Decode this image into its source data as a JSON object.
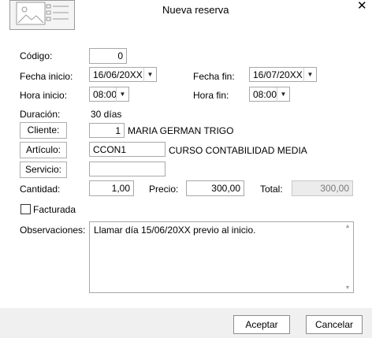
{
  "title": "Nueva reserva",
  "close_glyph": "✕",
  "icons": {
    "header": "image-list-icon",
    "close": "close-icon",
    "dropdown": "chevron-down-icon"
  },
  "labels": {
    "codigo": "Código:",
    "fecha_inicio": "Fecha inicio:",
    "fecha_fin": "Fecha fin:",
    "hora_inicio": "Hora inicio:",
    "hora_fin": "Hora fin:",
    "duracion": "Duración:",
    "cantidad": "Cantidad:",
    "precio": "Precio:",
    "total": "Total:",
    "observaciones": "Observaciones:",
    "facturada": "Facturada"
  },
  "values": {
    "codigo": "0",
    "fecha_inicio": "16/06/20XX",
    "fecha_fin": "16/07/20XX",
    "hora_inicio": "08:00",
    "hora_fin": "08:00",
    "duracion": "30 días",
    "cliente_id": "1",
    "cliente_name": "MARIA GERMAN TRIGO",
    "articulo_code": "CCON1",
    "articulo_name": "CURSO CONTABILIDAD MEDIA",
    "servicio": "",
    "cantidad": "1,00",
    "precio": "300,00",
    "total": "300,00",
    "observaciones": "Llamar día 15/06/20XX previo al inicio.",
    "facturada": false
  },
  "buttons": {
    "cliente": "Cliente:",
    "articulo": "Artículo:",
    "servicio": "Servicio:",
    "aceptar": "Aceptar",
    "cancelar": "Cancelar"
  }
}
